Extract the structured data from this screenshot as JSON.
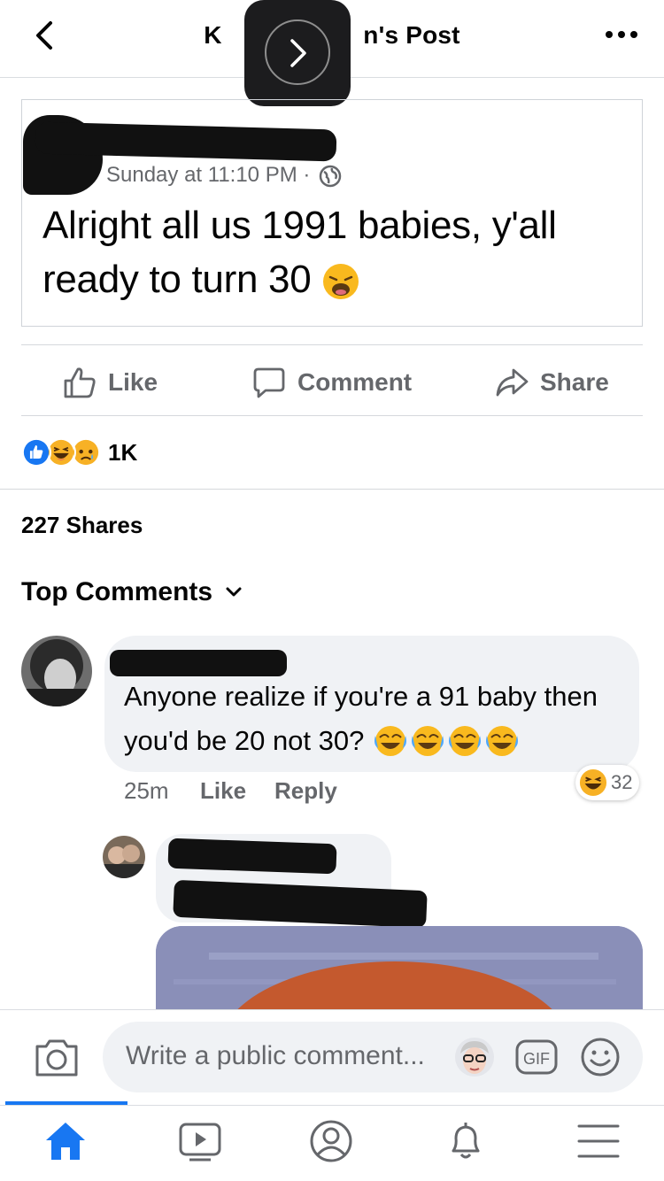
{
  "header": {
    "title": "K                    n's Post",
    "back_icon": "chevron-left-icon",
    "more_icon": "more-horizontal-icon"
  },
  "post": {
    "time": "Sunday at 11:10 PM ·",
    "text": "Alright all us 1991 babies, y'all ready to turn 30",
    "emoji": "weary-face"
  },
  "actions": {
    "like_label": "Like",
    "comment_label": "Comment",
    "share_label": "Share"
  },
  "reactions": {
    "count": "1K",
    "types": [
      "like",
      "haha",
      "sad"
    ]
  },
  "shares_label": "227 Shares",
  "top_comments_label": "Top Comments",
  "comment": {
    "text_line1": "Anyone realize if you're a 91 baby then",
    "text_line2": "you'd be 20 not 30?",
    "time": "25m",
    "like_label": "Like",
    "reply_label": "Reply",
    "reaction_count": "32"
  },
  "composer": {
    "placeholder": "Write a public comment..."
  },
  "colors": {
    "facebook_blue": "#1877f2",
    "secondary_text": "#65676b",
    "bubble_bg": "#f0f2f5"
  }
}
